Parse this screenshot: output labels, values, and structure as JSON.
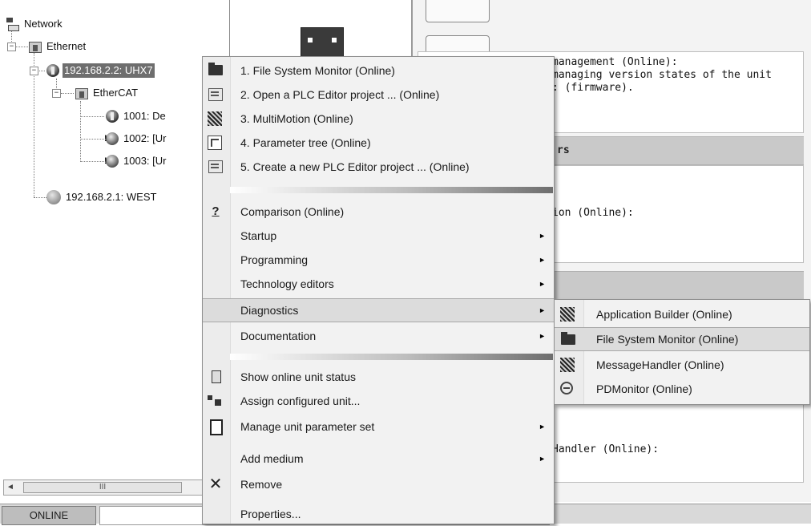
{
  "tree": {
    "network": "Network",
    "ethernet": "Ethernet",
    "unit": "192.168.2.2: UHX7",
    "ethercat": "EtherCAT",
    "dev1001": "1001: De",
    "dev1002": "1002: [Ur",
    "dev1003": "1003: [Ur",
    "west": "192.168.2.1: WEST"
  },
  "scrollbar": {
    "left_arrow": "◄",
    "thumb_grip": "III"
  },
  "status": {
    "mode": "ONLINE"
  },
  "right": {
    "text1": "management (Online):\nmanaging version states of the unit\n: (firmware).",
    "header1": "rs",
    "text2": "ion (Online):",
    "text3": "Handler (Online):"
  },
  "context_menu": {
    "items": [
      {
        "label": "1. File System Monitor (Online)",
        "icon": "folder-icon"
      },
      {
        "label": "2. Open a PLC Editor project ... (Online)",
        "icon": "plc-project-icon"
      },
      {
        "label": "3. MultiMotion (Online)",
        "icon": "multimotion-icon"
      },
      {
        "label": "4. Parameter tree (Online)",
        "icon": "parameter-tree-icon"
      },
      {
        "label": "5. Create a new PLC Editor project ... (Online)",
        "icon": "plc-project-icon"
      },
      {
        "label": "Comparison (Online)",
        "icon": "question-icon",
        "glyph": "?"
      },
      {
        "label": "Startup",
        "submenu": true
      },
      {
        "label": "Programming",
        "submenu": true
      },
      {
        "label": "Technology editors",
        "submenu": true
      },
      {
        "label": "Diagnostics",
        "submenu": true,
        "highlighted": true
      },
      {
        "label": "Documentation",
        "submenu": true
      },
      {
        "label": "Show online unit status",
        "icon": "unit-status-icon"
      },
      {
        "label": "Assign configured unit...",
        "icon": "assign-unit-icon"
      },
      {
        "label": "Manage unit parameter set",
        "icon": "parameter-set-icon",
        "submenu": true
      },
      {
        "label": "Add medium",
        "submenu": true
      },
      {
        "label": "Remove",
        "icon": "remove-icon",
        "glyph": "✕"
      },
      {
        "label": "Properties..."
      }
    ],
    "arrow_glyph": "►"
  },
  "diagnostics_submenu": {
    "items": [
      {
        "label": "Application Builder (Online)",
        "icon": "application-builder-icon"
      },
      {
        "label": "File System Monitor (Online)",
        "icon": "folder-icon",
        "highlighted": true
      },
      {
        "label": "MessageHandler (Online)",
        "icon": "message-handler-icon"
      },
      {
        "label": "PDMonitor (Online)",
        "icon": "pdmonitor-icon"
      }
    ]
  },
  "colors": {
    "selection": "#6e6e6e",
    "highlight": "#dcdcdc",
    "menu_bg": "#f2f2f2",
    "section_header": "#c9c9c9"
  }
}
